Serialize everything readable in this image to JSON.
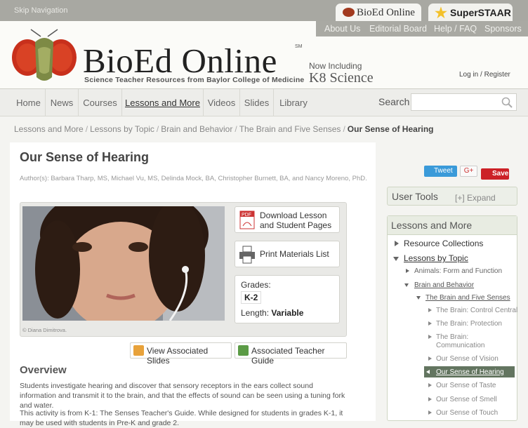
{
  "top": {
    "skip": "Skip Navigation",
    "tab_bioed": "BioEd Online",
    "tab_super": "SuperSTAAR"
  },
  "utility_links": [
    "About Us",
    "Editorial Board",
    "Help / FAQ",
    "Sponsors"
  ],
  "brand": {
    "name": "BioEd Online",
    "sm": "SM",
    "tagline": "Science Teacher Resources from Baylor College of Medicine",
    "now_including": "Now Including",
    "k8": "K8 Science",
    "login": "Log in",
    "slash": "/",
    "register": "Register"
  },
  "nav": [
    "Home",
    "News",
    "Courses",
    "Lessons and More",
    "Videos",
    "Slides",
    "Library"
  ],
  "search": {
    "label": "Search",
    "value": ""
  },
  "breadcrumbs": [
    "Lessons and More",
    "Lessons by Topic",
    "Brain and Behavior",
    "The Brain and Five Senses",
    "Our Sense of Hearing"
  ],
  "page": {
    "title": "Our Sense of Hearing",
    "authors": "Author(s): Barbara Tharp, MS, Michael Vu, MS, Delinda Mock, BA, Christopher Burnett, BA, and Nancy Moreno, PhD.",
    "photo_credit": "© Diana Dimitrova.",
    "download": "Download Lesson and Student Pages",
    "print": "Print Materials List",
    "grades_label": "Grades:",
    "grades_value": "K-2",
    "length_label": "Length:",
    "length_value": "Variable",
    "view_slides": "View Associated Slides",
    "teacher_guide": "Associated Teacher Guide",
    "overview_heading": "Overview",
    "overview_p1": "Students investigate hearing and discover that sensory receptors in the ears collect sound information and transmit it to the brain, and that the effects of sound can be seen using a tuning fork and water.",
    "overview_p2": "This activity is from K-1: The Senses Teacher's Guide. While designed for students in grades K-1, it may be used with students in Pre-K and grade 2."
  },
  "social": {
    "tweet": "Tweet",
    "gplus": "G+",
    "save": "Save"
  },
  "sidebar": {
    "user_tools": "User Tools",
    "expand": "[+] Expand",
    "lam_title": "Lessons and More",
    "resource_collections": "Resource Collections",
    "lessons_by_topic": "Lessons by Topic",
    "animals": "Animals: Form and Function",
    "brain_behavior": "Brain and Behavior",
    "five_senses": "The Brain and Five Senses",
    "leaves": [
      "The Brain: Control Central",
      "The Brain: Protection",
      "The Brain: Communication",
      "Our Sense of Vision",
      "Our Sense of Hearing",
      "Our Sense of Taste",
      "Our Sense of Smell",
      "Our Sense of Touch"
    ]
  }
}
